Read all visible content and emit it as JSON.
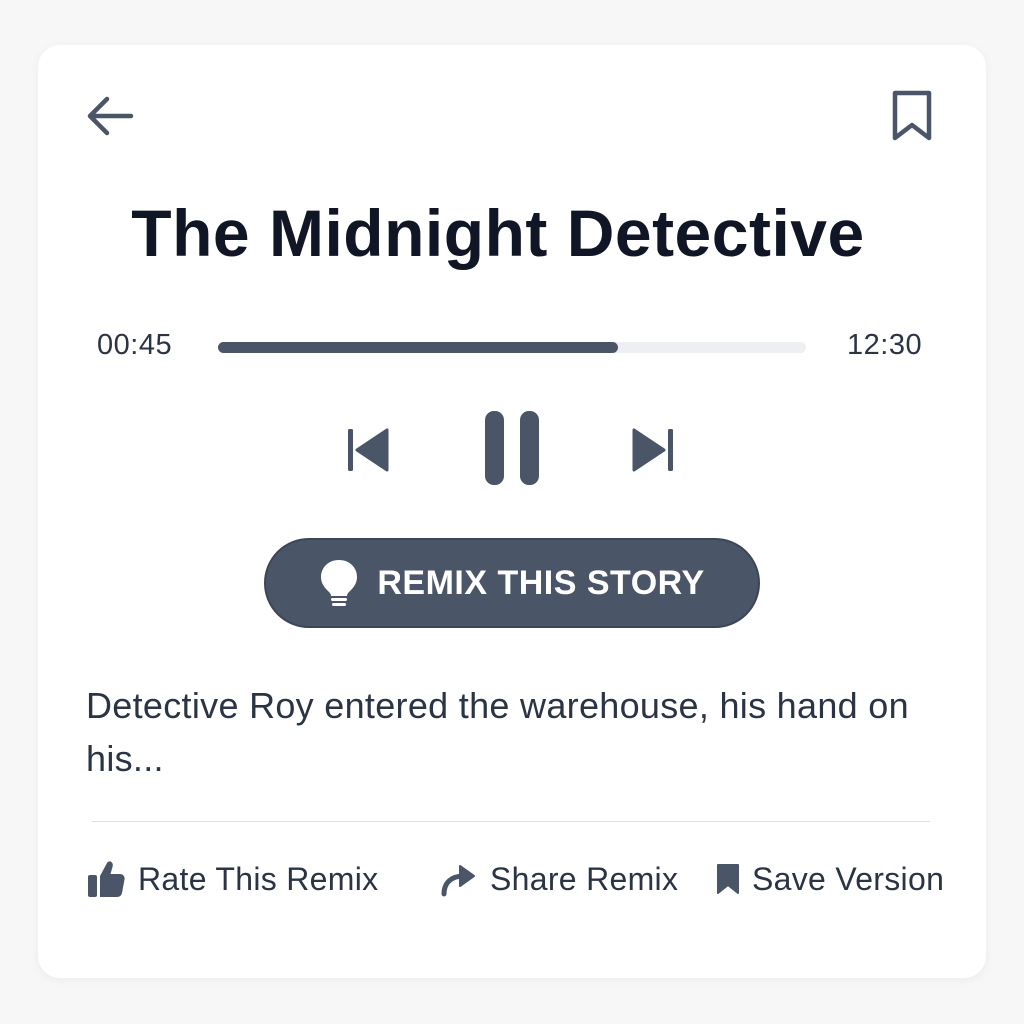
{
  "colors": {
    "accent": "#4a5668",
    "title_text": "#101625",
    "body_text": "#2b3444",
    "track": "#eeeff2",
    "background": "#f7f7f8",
    "card": "#ffffff"
  },
  "header": {
    "back_icon": "arrow-left-icon",
    "bookmark_icon": "bookmark-outline-icon"
  },
  "story": {
    "title": "The Midnight Detective",
    "excerpt": "Detective Roy entered the warehouse, his hand on his..."
  },
  "player": {
    "current_time": "00:45",
    "total_time": "12:30",
    "progress_fraction": 0.68,
    "controls": {
      "previous_icon": "skip-previous-icon",
      "pause_icon": "pause-icon",
      "next_icon": "skip-next-icon"
    }
  },
  "remix_button": {
    "label": "REMIX THIS STORY",
    "icon": "lightbulb-icon"
  },
  "actions": [
    {
      "label": "Rate This Remix",
      "icon": "thumbs-up-icon"
    },
    {
      "label": "Share Remix",
      "icon": "share-arrow-icon"
    },
    {
      "label": "Save Version",
      "icon": "bookmark-filled-icon"
    }
  ]
}
